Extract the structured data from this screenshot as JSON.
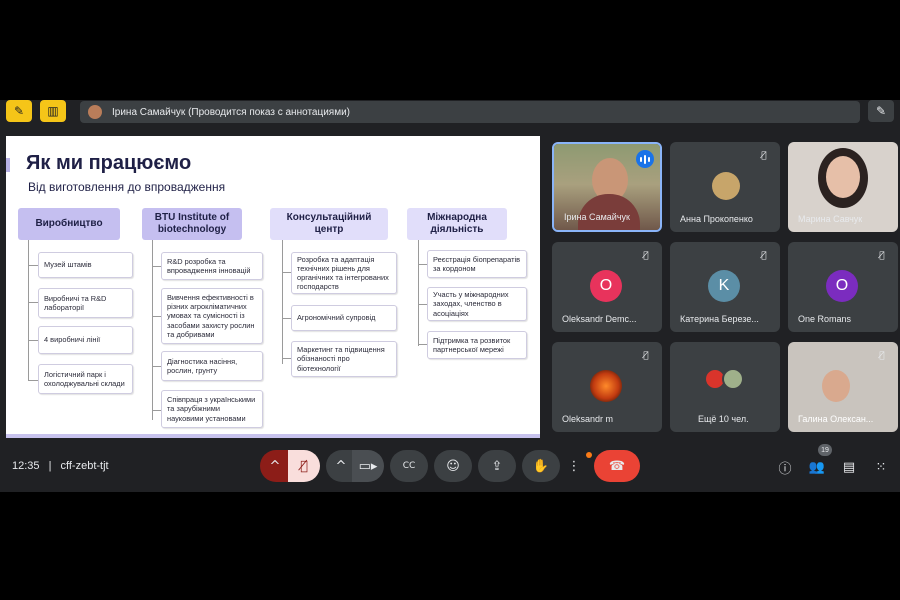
{
  "banner": {
    "text": "Ірина Самайчук (Проводится показ с аннотациями)"
  },
  "slide": {
    "title": "Як ми працюємо",
    "subtitle": "Від виготовлення до впровадження",
    "columns": [
      {
        "heading": "Виробництво",
        "items": [
          "Музей штамів",
          "Виробничі та R&D лабораторії",
          "4 виробничі лінії",
          "Логістичний парк і охолоджувальні склади"
        ]
      },
      {
        "heading": "BTU Institute of biotechnology",
        "items": [
          "R&D розробка та впровадження інновацій",
          "Вивчення ефективності в різних агрокліматичних умовах та сумісності із засобами захисту рослин та добривами",
          "Діагностика насіння, рослин, грунту",
          "Співпраця з українськими та зарубіжними науковими установами"
        ]
      },
      {
        "heading": "Консультаційний центр",
        "items": [
          "Розробка та адаптація технічних рішень для органічних та інтегрованих господарств",
          "Агрономічний супровід",
          "Маркетинг та підвищення обізнаності про біотехнології"
        ]
      },
      {
        "heading": "Міжнародна діяльність",
        "items": [
          "Реєстрація біопрепаратів за кордоном",
          "Участь у міжнародних заходах, членство в асоціаціях",
          "Підтримка та розвиток партнерської мережі"
        ]
      }
    ]
  },
  "participants": [
    {
      "name": "Ірина Самайчук"
    },
    {
      "name": "Анна Прокопенко"
    },
    {
      "name": "Марина Савчук"
    },
    {
      "name": "Oleksandr Demc...",
      "initial": "O",
      "color": "#e8335c"
    },
    {
      "name": "Катерина Березе...",
      "initial": "K",
      "color": "#5b8ea6"
    },
    {
      "name": "One Romans",
      "initial": "O",
      "color": "#7b2cbf"
    },
    {
      "name": "Oleksandr m"
    },
    {
      "name": "Ещё 10 чел."
    },
    {
      "name": "Галина Олексан..."
    }
  ],
  "meeting": {
    "time": "12:35",
    "separator": "|",
    "code": "cff-zebt-tjt",
    "participant_count": "19"
  },
  "icons": {
    "hand": "hand-icon",
    "mic_off": "mic-off-icon",
    "camera": "camera-icon",
    "captions": "captions-icon",
    "emoji": "emoji-icon",
    "present": "present-icon",
    "raise_hand": "raise-hand-icon",
    "more": "more-icon",
    "end_call": "end-call-icon",
    "info": "info-icon",
    "people": "people-icon",
    "chat": "chat-icon",
    "apps": "apps-icon",
    "annotate": "pen-icon"
  },
  "colors": {
    "end_call": "#ea4335",
    "accent": "#8ab4f8",
    "toolbar_yellow": "#f5c518"
  }
}
